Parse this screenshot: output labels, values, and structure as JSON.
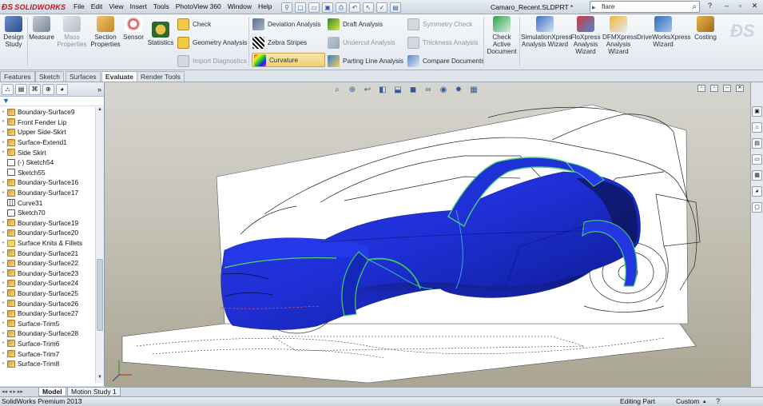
{
  "app": {
    "logo": "SOLIDWORKS",
    "title": "Camaro_Recent.SLDPRT *"
  },
  "menu": [
    "File",
    "Edit",
    "View",
    "Insert",
    "Tools",
    "PhotoView 360",
    "Window",
    "Help"
  ],
  "search": {
    "value": "flare"
  },
  "ribbon": {
    "design_study": "Design Study",
    "measure": "Measure",
    "mass_properties": "Mass Properties",
    "section_properties": "Section Properties",
    "sensor": "Sensor",
    "statistics": "Statistics",
    "check": "Check",
    "geometry_analysis": "Geometry Analysis",
    "import_diagnostics": "Import Diagnostics",
    "deviation_analysis": "Deviation Analysis",
    "zebra_stripes": "Zebra Stripes",
    "curvature": "Curvature",
    "draft_analysis": "Draft Analysis",
    "undercut_analysis": "Undercut Analysis",
    "parting_line_analysis": "Parting Line Analysis",
    "symmetry_check": "Symmetry Check",
    "thickness_analysis": "Thickness Analysis",
    "compare_documents": "Compare Documents",
    "check_active_document": "Check Active Document",
    "simulationxpress": "SimulationXpress Analysis Wizard",
    "floxpress": "FloXpress Analysis Wizard",
    "dfmxpress": "DFMXpress Analysis Wizard",
    "driveworksxpress": "DriveWorksXpress Wizard",
    "costing": "Costing"
  },
  "tabs": [
    "Features",
    "Sketch",
    "Surfaces",
    "Evaluate",
    "Render Tools"
  ],
  "active_tab": "Evaluate",
  "tree": [
    {
      "label": "Boundary-Surface9",
      "type": "surf"
    },
    {
      "label": "Front Fender Lip",
      "type": "surf"
    },
    {
      "label": "Upper Side-Skirt",
      "type": "surf"
    },
    {
      "label": "Surface-Extend1",
      "type": "surf"
    },
    {
      "label": "Side Skirt",
      "type": "surf"
    },
    {
      "label": "(-) Sketch54",
      "type": "sketch"
    },
    {
      "label": "Sketch55",
      "type": "sketch"
    },
    {
      "label": "Boundary-Surface16",
      "type": "surf"
    },
    {
      "label": "Boundary-Surface17",
      "type": "surf"
    },
    {
      "label": "Curve31",
      "type": "curve"
    },
    {
      "label": "Sketch70",
      "type": "sketch"
    },
    {
      "label": "Boundary-Surface19",
      "type": "surf"
    },
    {
      "label": "Boundary-Surface20",
      "type": "surf"
    },
    {
      "label": "Surface Knits & Fillets",
      "type": "folder"
    },
    {
      "label": "Boundary-Surface21",
      "type": "surf"
    },
    {
      "label": "Boundary-Surface22",
      "type": "surf"
    },
    {
      "label": "Boundary-Surface23",
      "type": "surf"
    },
    {
      "label": "Boundary-Surface24",
      "type": "surf"
    },
    {
      "label": "Boundary-Surface25",
      "type": "surf"
    },
    {
      "label": "Boundary-Surface26",
      "type": "surf"
    },
    {
      "label": "Boundary-Surface27",
      "type": "surf"
    },
    {
      "label": "Surface-Trim5",
      "type": "surf"
    },
    {
      "label": "Boundary-Surface28",
      "type": "surf"
    },
    {
      "label": "Surface-Trim6",
      "type": "surf"
    },
    {
      "label": "Surface-Trim7",
      "type": "surf"
    },
    {
      "label": "Surface-Trim8",
      "type": "surf"
    }
  ],
  "bottom_tabs": {
    "model": "Model",
    "motion_study": "Motion Study 1"
  },
  "status": {
    "product": "SolidWorks Premium 2013",
    "editing": "Editing Part",
    "units": "Custom"
  }
}
